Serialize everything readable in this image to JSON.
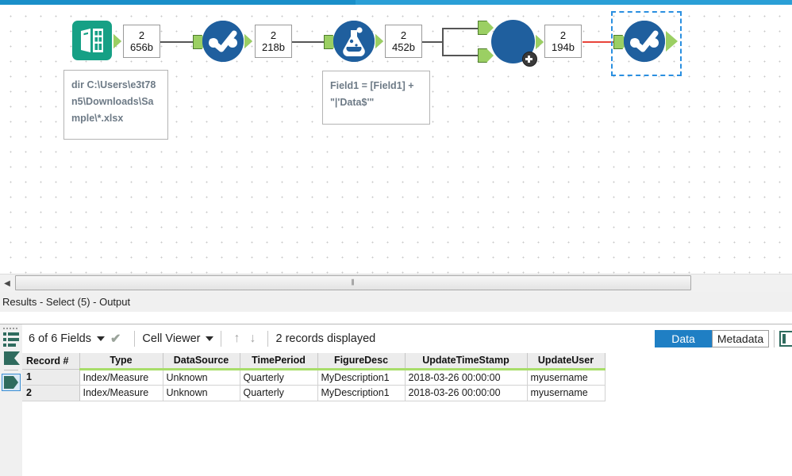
{
  "window": {
    "accent_color": "#2a9fd6"
  },
  "canvas": {
    "tools": [
      {
        "id": "directory",
        "icon": "directory-book-icon",
        "label": "Directory"
      },
      {
        "id": "select-1",
        "icon": "select-tool-icon",
        "label": "Select"
      },
      {
        "id": "formula",
        "icon": "formula-flask-icon",
        "label": "Formula"
      },
      {
        "id": "dynamic-input",
        "icon": "dynamic-input-circle-icon",
        "label": "Dynamic Input"
      },
      {
        "id": "select-5",
        "icon": "select-tool-icon",
        "label": "Select (5)"
      }
    ],
    "connection_labels": [
      {
        "records": "2",
        "size": "656b"
      },
      {
        "records": "2",
        "size": "218b"
      },
      {
        "records": "2",
        "size": "452b"
      },
      {
        "records": "2",
        "size": "194b"
      }
    ],
    "annotations": [
      {
        "id": "directory-annotation",
        "text": "dir C:\\Users\\e3t78n5\\Downloads\\Sample\\*.xlsx"
      },
      {
        "id": "formula-annotation",
        "text": "Field1 = [Field1] + \"|'Data$'\""
      }
    ],
    "scrollbar": {
      "left_arrow": "◀",
      "grip": "⦀"
    }
  },
  "results": {
    "title": "Results - Select (5) - Output",
    "toolbar": {
      "fields_label": "6 of 6 Fields",
      "viewer_label": "Cell Viewer",
      "up_arrow": "↑",
      "down_arrow": "↓",
      "records_status": "2 records displayed",
      "data_tab": "Data",
      "metadata_tab": "Metadata"
    },
    "table": {
      "columns": [
        "Record #",
        "Type",
        "DataSource",
        "TimePeriod",
        "FigureDesc",
        "UpdateTimeStamp",
        "UpdateUser"
      ],
      "rows": [
        [
          "1",
          "Index/Measure",
          "Unknown",
          "Quarterly",
          "MyDescription1",
          "2018-03-26 00:00:00",
          "myusername"
        ],
        [
          "2",
          "Index/Measure",
          "Unknown",
          "Quarterly",
          "MyDescription1",
          "2018-03-26 00:00:00",
          "myusername"
        ]
      ]
    }
  }
}
